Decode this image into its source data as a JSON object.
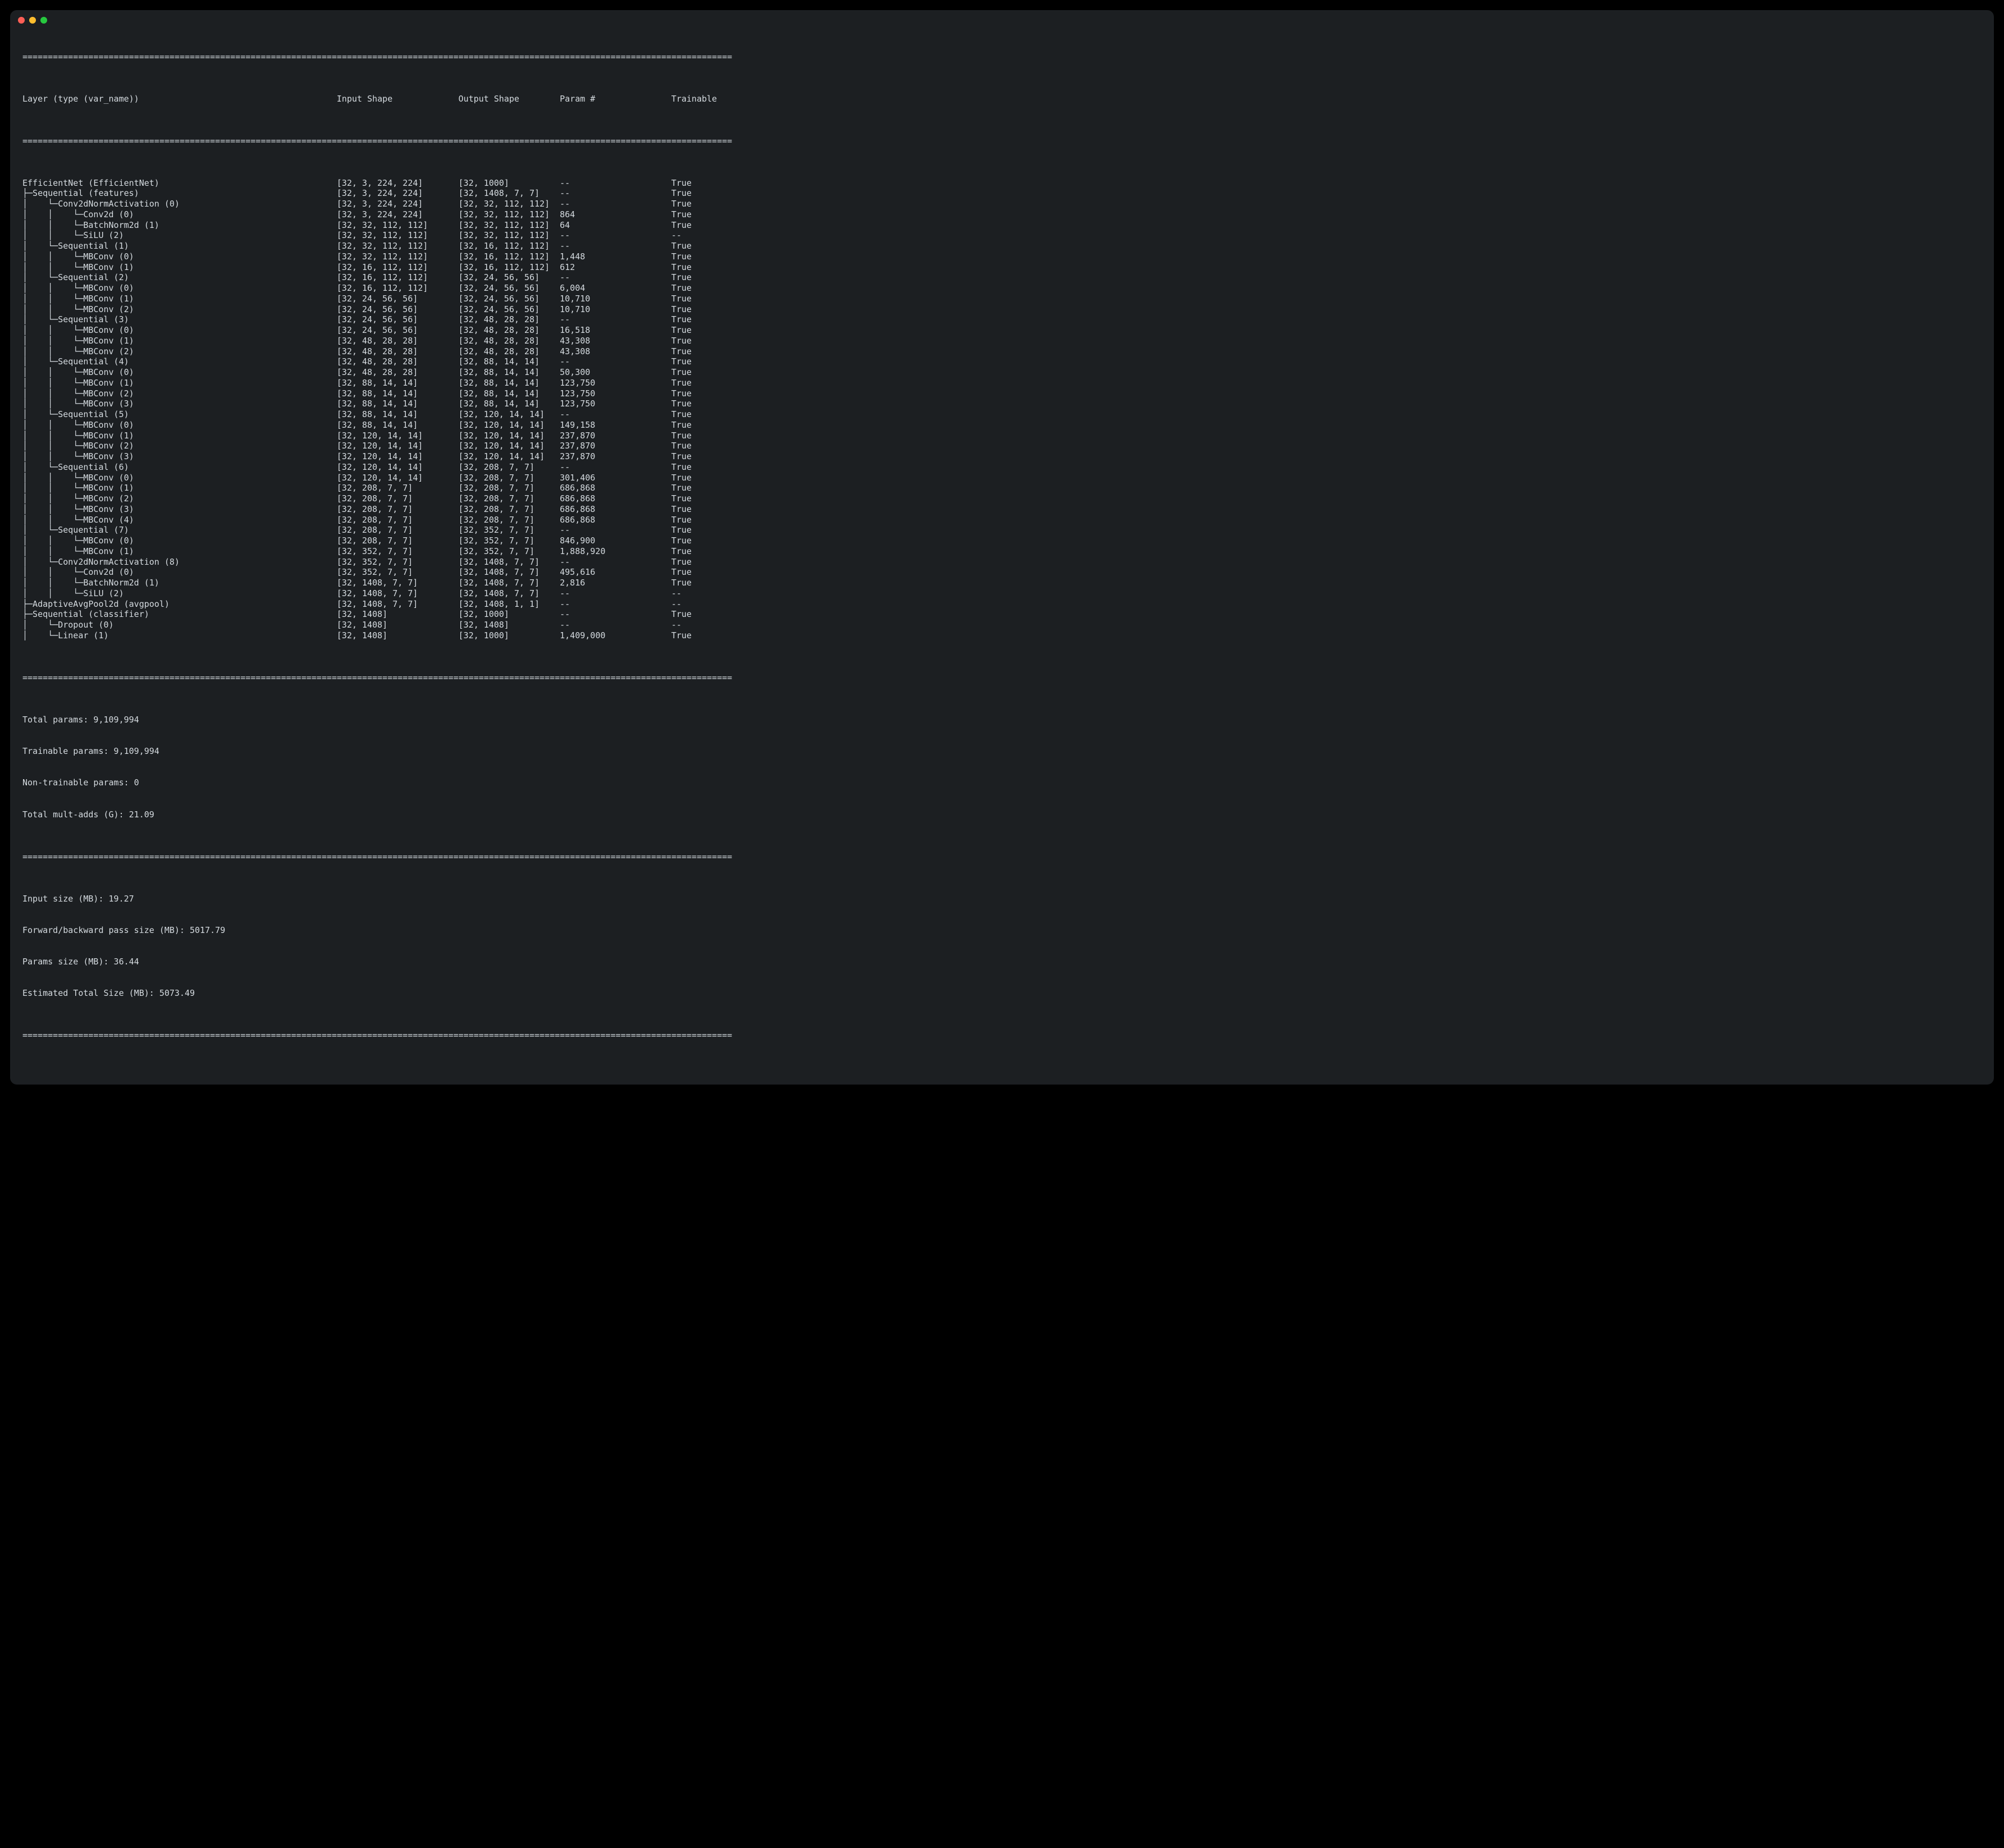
{
  "cols": {
    "layer": "Layer (type (var_name))",
    "in": "Input Shape",
    "out": "Output Shape",
    "param": "Param #",
    "train": "Trainable"
  },
  "rows": [
    {
      "layer": "EfficientNet (EfficientNet)",
      "in": "[32, 3, 224, 224]",
      "out": "[32, 1000]",
      "param": "--",
      "train": "True"
    },
    {
      "layer": "├─Sequential (features)",
      "in": "[32, 3, 224, 224]",
      "out": "[32, 1408, 7, 7]",
      "param": "--",
      "train": "True"
    },
    {
      "layer": "│    └─Conv2dNormActivation (0)",
      "in": "[32, 3, 224, 224]",
      "out": "[32, 32, 112, 112]",
      "param": "--",
      "train": "True"
    },
    {
      "layer": "│    │    └─Conv2d (0)",
      "in": "[32, 3, 224, 224]",
      "out": "[32, 32, 112, 112]",
      "param": "864",
      "train": "True"
    },
    {
      "layer": "│    │    └─BatchNorm2d (1)",
      "in": "[32, 32, 112, 112]",
      "out": "[32, 32, 112, 112]",
      "param": "64",
      "train": "True"
    },
    {
      "layer": "│    │    └─SiLU (2)",
      "in": "[32, 32, 112, 112]",
      "out": "[32, 32, 112, 112]",
      "param": "--",
      "train": "--"
    },
    {
      "layer": "│    └─Sequential (1)",
      "in": "[32, 32, 112, 112]",
      "out": "[32, 16, 112, 112]",
      "param": "--",
      "train": "True"
    },
    {
      "layer": "│    │    └─MBConv (0)",
      "in": "[32, 32, 112, 112]",
      "out": "[32, 16, 112, 112]",
      "param": "1,448",
      "train": "True"
    },
    {
      "layer": "│    │    └─MBConv (1)",
      "in": "[32, 16, 112, 112]",
      "out": "[32, 16, 112, 112]",
      "param": "612",
      "train": "True"
    },
    {
      "layer": "│    └─Sequential (2)",
      "in": "[32, 16, 112, 112]",
      "out": "[32, 24, 56, 56]",
      "param": "--",
      "train": "True"
    },
    {
      "layer": "│    │    └─MBConv (0)",
      "in": "[32, 16, 112, 112]",
      "out": "[32, 24, 56, 56]",
      "param": "6,004",
      "train": "True"
    },
    {
      "layer": "│    │    └─MBConv (1)",
      "in": "[32, 24, 56, 56]",
      "out": "[32, 24, 56, 56]",
      "param": "10,710",
      "train": "True"
    },
    {
      "layer": "│    │    └─MBConv (2)",
      "in": "[32, 24, 56, 56]",
      "out": "[32, 24, 56, 56]",
      "param": "10,710",
      "train": "True"
    },
    {
      "layer": "│    └─Sequential (3)",
      "in": "[32, 24, 56, 56]",
      "out": "[32, 48, 28, 28]",
      "param": "--",
      "train": "True"
    },
    {
      "layer": "│    │    └─MBConv (0)",
      "in": "[32, 24, 56, 56]",
      "out": "[32, 48, 28, 28]",
      "param": "16,518",
      "train": "True"
    },
    {
      "layer": "│    │    └─MBConv (1)",
      "in": "[32, 48, 28, 28]",
      "out": "[32, 48, 28, 28]",
      "param": "43,308",
      "train": "True"
    },
    {
      "layer": "│    │    └─MBConv (2)",
      "in": "[32, 48, 28, 28]",
      "out": "[32, 48, 28, 28]",
      "param": "43,308",
      "train": "True"
    },
    {
      "layer": "│    └─Sequential (4)",
      "in": "[32, 48, 28, 28]",
      "out": "[32, 88, 14, 14]",
      "param": "--",
      "train": "True"
    },
    {
      "layer": "│    │    └─MBConv (0)",
      "in": "[32, 48, 28, 28]",
      "out": "[32, 88, 14, 14]",
      "param": "50,300",
      "train": "True"
    },
    {
      "layer": "│    │    └─MBConv (1)",
      "in": "[32, 88, 14, 14]",
      "out": "[32, 88, 14, 14]",
      "param": "123,750",
      "train": "True"
    },
    {
      "layer": "│    │    └─MBConv (2)",
      "in": "[32, 88, 14, 14]",
      "out": "[32, 88, 14, 14]",
      "param": "123,750",
      "train": "True"
    },
    {
      "layer": "│    │    └─MBConv (3)",
      "in": "[32, 88, 14, 14]",
      "out": "[32, 88, 14, 14]",
      "param": "123,750",
      "train": "True"
    },
    {
      "layer": "│    └─Sequential (5)",
      "in": "[32, 88, 14, 14]",
      "out": "[32, 120, 14, 14]",
      "param": "--",
      "train": "True"
    },
    {
      "layer": "│    │    └─MBConv (0)",
      "in": "[32, 88, 14, 14]",
      "out": "[32, 120, 14, 14]",
      "param": "149,158",
      "train": "True"
    },
    {
      "layer": "│    │    └─MBConv (1)",
      "in": "[32, 120, 14, 14]",
      "out": "[32, 120, 14, 14]",
      "param": "237,870",
      "train": "True"
    },
    {
      "layer": "│    │    └─MBConv (2)",
      "in": "[32, 120, 14, 14]",
      "out": "[32, 120, 14, 14]",
      "param": "237,870",
      "train": "True"
    },
    {
      "layer": "│    │    └─MBConv (3)",
      "in": "[32, 120, 14, 14]",
      "out": "[32, 120, 14, 14]",
      "param": "237,870",
      "train": "True"
    },
    {
      "layer": "│    └─Sequential (6)",
      "in": "[32, 120, 14, 14]",
      "out": "[32, 208, 7, 7]",
      "param": "--",
      "train": "True"
    },
    {
      "layer": "│    │    └─MBConv (0)",
      "in": "[32, 120, 14, 14]",
      "out": "[32, 208, 7, 7]",
      "param": "301,406",
      "train": "True"
    },
    {
      "layer": "│    │    └─MBConv (1)",
      "in": "[32, 208, 7, 7]",
      "out": "[32, 208, 7, 7]",
      "param": "686,868",
      "train": "True"
    },
    {
      "layer": "│    │    └─MBConv (2)",
      "in": "[32, 208, 7, 7]",
      "out": "[32, 208, 7, 7]",
      "param": "686,868",
      "train": "True"
    },
    {
      "layer": "│    │    └─MBConv (3)",
      "in": "[32, 208, 7, 7]",
      "out": "[32, 208, 7, 7]",
      "param": "686,868",
      "train": "True"
    },
    {
      "layer": "│    │    └─MBConv (4)",
      "in": "[32, 208, 7, 7]",
      "out": "[32, 208, 7, 7]",
      "param": "686,868",
      "train": "True"
    },
    {
      "layer": "│    └─Sequential (7)",
      "in": "[32, 208, 7, 7]",
      "out": "[32, 352, 7, 7]",
      "param": "--",
      "train": "True"
    },
    {
      "layer": "│    │    └─MBConv (0)",
      "in": "[32, 208, 7, 7]",
      "out": "[32, 352, 7, 7]",
      "param": "846,900",
      "train": "True"
    },
    {
      "layer": "│    │    └─MBConv (1)",
      "in": "[32, 352, 7, 7]",
      "out": "[32, 352, 7, 7]",
      "param": "1,888,920",
      "train": "True"
    },
    {
      "layer": "│    └─Conv2dNormActivation (8)",
      "in": "[32, 352, 7, 7]",
      "out": "[32, 1408, 7, 7]",
      "param": "--",
      "train": "True"
    },
    {
      "layer": "│    │    └─Conv2d (0)",
      "in": "[32, 352, 7, 7]",
      "out": "[32, 1408, 7, 7]",
      "param": "495,616",
      "train": "True"
    },
    {
      "layer": "│    │    └─BatchNorm2d (1)",
      "in": "[32, 1408, 7, 7]",
      "out": "[32, 1408, 7, 7]",
      "param": "2,816",
      "train": "True"
    },
    {
      "layer": "│    │    └─SiLU (2)",
      "in": "[32, 1408, 7, 7]",
      "out": "[32, 1408, 7, 7]",
      "param": "--",
      "train": "--"
    },
    {
      "layer": "├─AdaptiveAvgPool2d (avgpool)",
      "in": "[32, 1408, 7, 7]",
      "out": "[32, 1408, 1, 1]",
      "param": "--",
      "train": "--"
    },
    {
      "layer": "├─Sequential (classifier)",
      "in": "[32, 1408]",
      "out": "[32, 1000]",
      "param": "--",
      "train": "True"
    },
    {
      "layer": "│    └─Dropout (0)",
      "in": "[32, 1408]",
      "out": "[32, 1408]",
      "param": "--",
      "train": "--"
    },
    {
      "layer": "│    └─Linear (1)",
      "in": "[32, 1408]",
      "out": "[32, 1000]",
      "param": "1,409,000",
      "train": "True"
    }
  ],
  "summary1": {
    "total_params": "Total params: 9,109,994",
    "trainable": "Trainable params: 9,109,994",
    "non_trainable": "Non-trainable params: 0",
    "multadds": "Total mult-adds (G): 21.09"
  },
  "summary2": {
    "input_size": "Input size (MB): 19.27",
    "fwdbwd": "Forward/backward pass size (MB): 5017.79",
    "params_size": "Params size (MB): 36.44",
    "est_total": "Estimated Total Size (MB): 5073.49"
  }
}
